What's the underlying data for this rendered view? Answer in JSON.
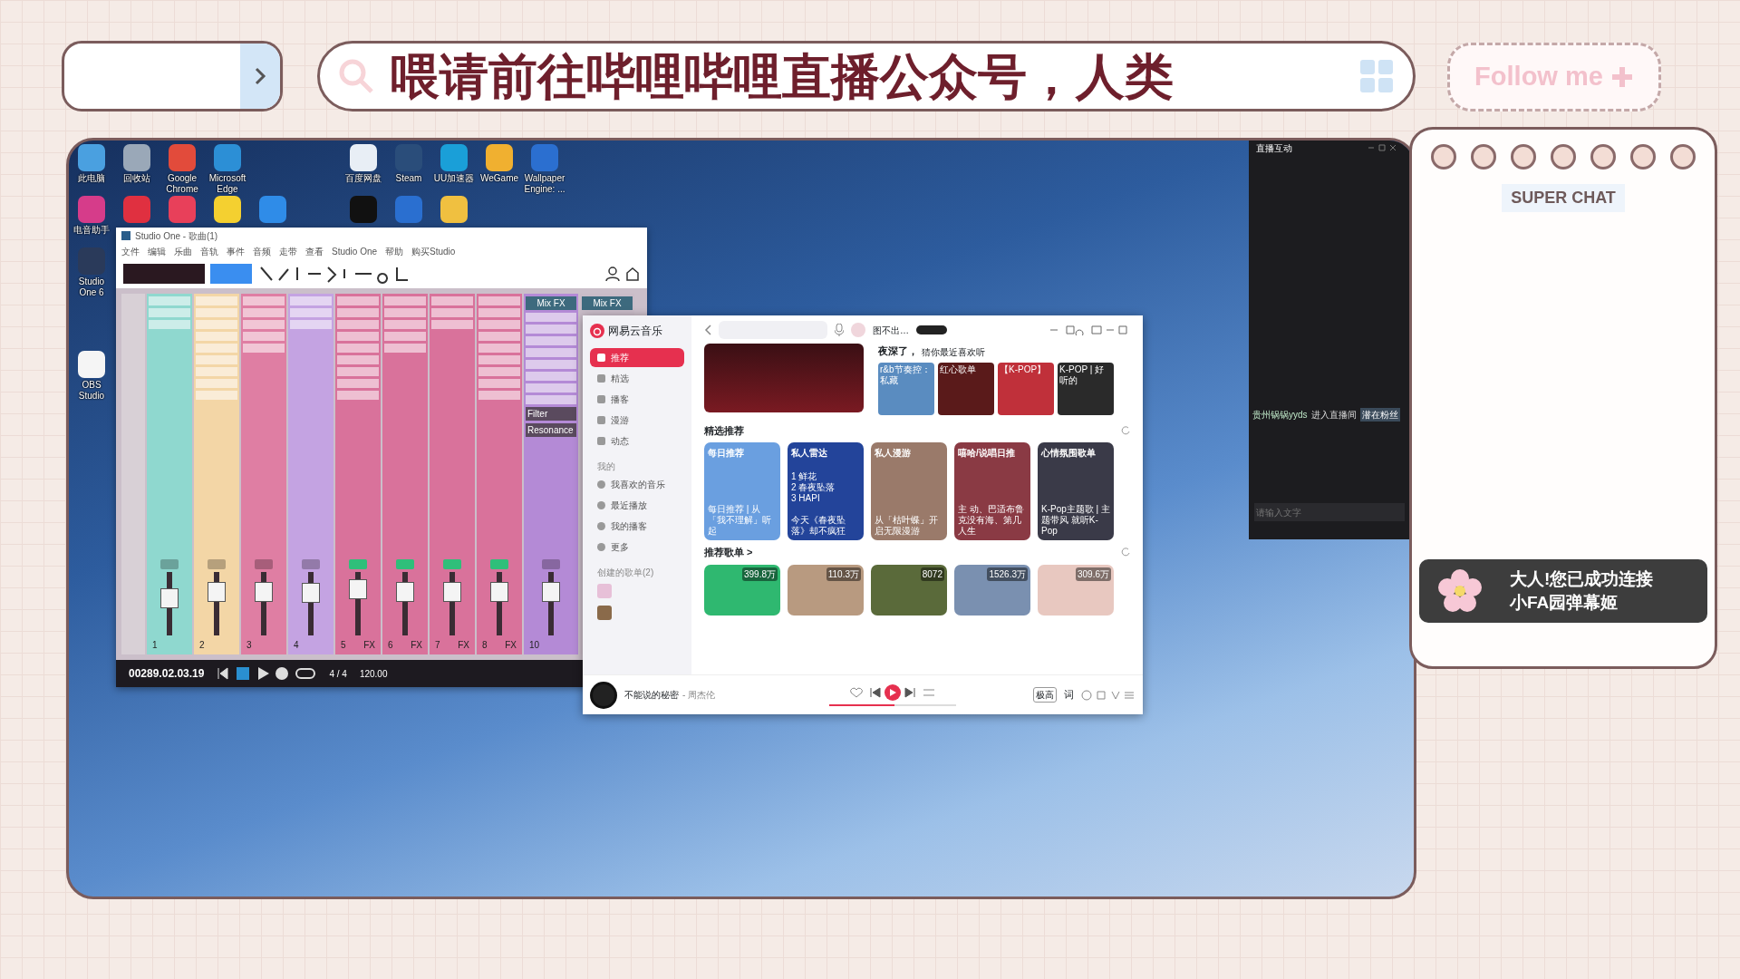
{
  "overlay": {
    "ticker": "喂请前往哔哩哔哩直播公众号，人类",
    "follow_button": "Follow me"
  },
  "desktop": {
    "icons": [
      {
        "label": "此电脑"
      },
      {
        "label": "回收站"
      },
      {
        "label": "Google Chrome"
      },
      {
        "label": "Microsoft Edge"
      },
      {
        "label": "百度网盘"
      },
      {
        "label": "Steam"
      },
      {
        "label": "UU加速器"
      },
      {
        "label": "WeGame"
      },
      {
        "label": "Wallpaper Engine: ..."
      },
      {
        "label": "电音助手"
      },
      {
        "label": "Studio One 6"
      },
      {
        "label": "OBS Studio"
      }
    ]
  },
  "daw": {
    "title": "Studio One - 歌曲(1)",
    "menu": [
      "文件",
      "编辑",
      "乐曲",
      "音轨",
      "事件",
      "音频",
      "走带",
      "查看",
      "Studio One",
      "帮助",
      "购买Studio"
    ],
    "channels": [
      {
        "number": "1",
        "color": "#8fd8cf",
        "level": 0.62,
        "monitor": false
      },
      {
        "number": "2",
        "color": "#f3d6a6",
        "level": 0.78,
        "monitor": false
      },
      {
        "number": "3",
        "color": "#df7ea3",
        "level": 0.78,
        "monitor": false
      },
      {
        "number": "4",
        "color": "#c4a3e2",
        "level": 0.75,
        "monitor": false
      },
      {
        "number": "5",
        "color": "#d9729b",
        "level": 0.83,
        "monitor": true,
        "fx_label": "FX"
      },
      {
        "number": "6",
        "color": "#d9729b",
        "level": 0.78,
        "monitor": true,
        "fx_label": "FX"
      },
      {
        "number": "7",
        "color": "#d9729b",
        "level": 0.78,
        "monitor": true,
        "fx_label": "FX"
      },
      {
        "number": "8",
        "color": "#d9729b",
        "level": 0.78,
        "monitor": true,
        "fx_label": "FX"
      },
      {
        "number": "10",
        "color": "#b48ad6",
        "level": 0.78,
        "monitor": false,
        "header": "Mix FX",
        "params": [
          "Filter",
          "Resonance"
        ]
      }
    ],
    "extra_header": "Mix FX",
    "transport": {
      "time": "00289.02.03.19",
      "signature": "4 / 4",
      "tempo": "120.00"
    }
  },
  "music": {
    "brand": "网易云音乐",
    "user": "图不出…",
    "nav": [
      {
        "label": "推荐",
        "selected": true
      },
      {
        "label": "精选",
        "selected": false
      },
      {
        "label": "播客",
        "selected": false
      },
      {
        "label": "漫游",
        "selected": false
      },
      {
        "label": "动态",
        "selected": false
      }
    ],
    "my_heading": "我的",
    "my_items": [
      "我喜欢的音乐",
      "最近播放",
      "我的播客",
      "更多"
    ],
    "created_heading": "创建的歌单(2)",
    "night": {
      "title": "夜深了，",
      "subtitle": "猜你最近喜欢听",
      "minis": [
        "r&b节奏控：私藏",
        "红心歌单",
        "【K-POP】",
        "K-POP | 好听的"
      ]
    },
    "featured_heading": "精选推荐",
    "featured": [
      {
        "title": "每日推荐",
        "caption": "每日推荐 | 从「我不理解」听起",
        "color": "#6a9fe0"
      },
      {
        "title": "私人雷达",
        "caption": "今天《春夜坠落》却不疯狂",
        "color": "#23449a",
        "tracks": [
          "1 鲜花",
          "2 春夜坠落",
          "3 HAPI"
        ]
      },
      {
        "title": "私人漫游",
        "caption": "从「枯叶蝶」开启无限漫游",
        "color": "#9a7a6a"
      },
      {
        "title": "嘻哈/说唱日推",
        "caption": "主 动、巴适布鲁克没有海、第几人生",
        "color": "#8a3a44"
      },
      {
        "title": "心情氛围歌单",
        "caption": "K-Pop主题歌 | 主题带风 就听K-Pop",
        "color": "#3a3a48"
      }
    ],
    "playlists_heading": "推荐歌单 >",
    "playlists": [
      {
        "plays": "399.8万",
        "color": "#2fb870"
      },
      {
        "plays": "110.3万",
        "color": "#b89a80"
      },
      {
        "plays": "8072",
        "color": "#5a6a3a"
      },
      {
        "plays": "1526.3万",
        "color": "#7a90b0"
      },
      {
        "plays": "309.6万",
        "color": "#e8c8c0"
      }
    ],
    "player": {
      "song": "不能说的秘密",
      "artist": "- 周杰伦",
      "quality": "极高",
      "lyrics": "词",
      "progress": {
        "level": 0.52
      }
    }
  },
  "chat": {
    "title": "直播互动",
    "user": "贵州锅锅yyds",
    "action": "进入直播间",
    "tag": "潜在粉丝",
    "placeholder": "请输入文字"
  },
  "superchat": {
    "title": "SUPER CHAT",
    "notice": [
      "大人!您已成功连接",
      "小FA园弹幕姬"
    ]
  }
}
